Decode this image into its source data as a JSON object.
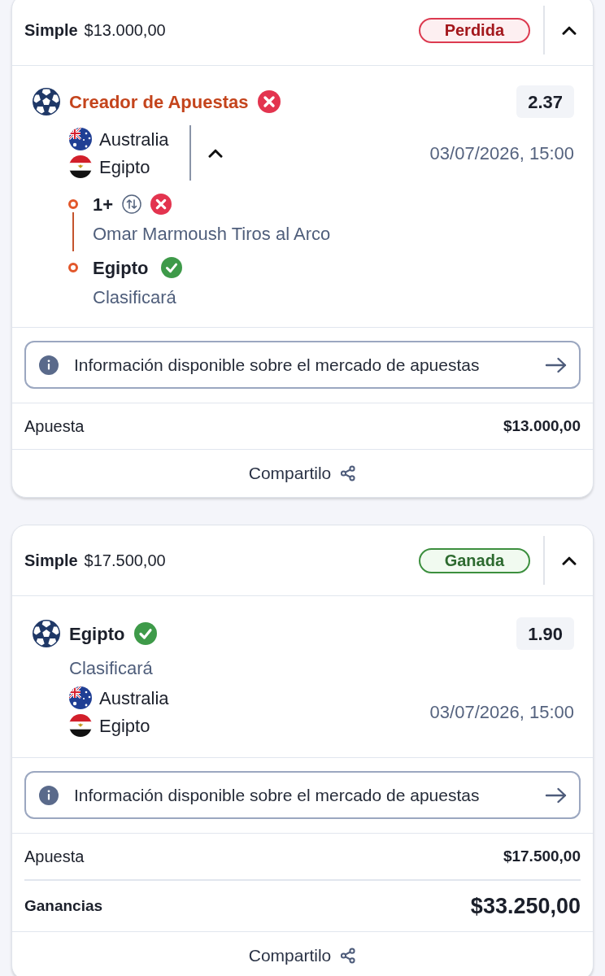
{
  "bets": [
    {
      "bet_type": "Simple",
      "amount": "$13.000,00",
      "status": {
        "label": "Perdida",
        "kind": "lost"
      },
      "expanded": true,
      "selection": {
        "kind": "builder",
        "title": "Creador de Apuestas",
        "won": false,
        "odds": "2.37",
        "match": {
          "teams": [
            "Australia",
            "Egipto"
          ],
          "expanded": true,
          "date": "03/07/2026, 15:00"
        },
        "legs": [
          {
            "kind": "line",
            "value": "1+",
            "won": false,
            "description": "Omar Marmoush Tiros al Arco"
          },
          {
            "kind": "outcome",
            "value": "Egipto",
            "won": true,
            "description": "Clasificará"
          }
        ]
      },
      "info_button": "Información disponible sobre el mercado de apuestas",
      "rows": [
        {
          "kind": "stake",
          "label": "Apuesta",
          "value": "$13.000,00"
        }
      ],
      "share": "Compartilo"
    },
    {
      "bet_type": "Simple",
      "amount": "$17.500,00",
      "status": {
        "label": "Ganada",
        "kind": "won"
      },
      "expanded": true,
      "selection": {
        "kind": "single",
        "title": "Egipto",
        "won": true,
        "odds": "1.90",
        "description": "Clasificará",
        "match": {
          "teams": [
            "Australia",
            "Egipto"
          ],
          "date": "03/07/2026, 15:00"
        }
      },
      "info_button": "Información disponible sobre el mercado de apuestas",
      "rows": [
        {
          "kind": "stake",
          "label": "Apuesta",
          "value": "$17.500,00"
        },
        {
          "kind": "winnings",
          "label": "Ganancias",
          "value": "$33.250,00"
        }
      ],
      "share": "Compartilo"
    }
  ]
}
